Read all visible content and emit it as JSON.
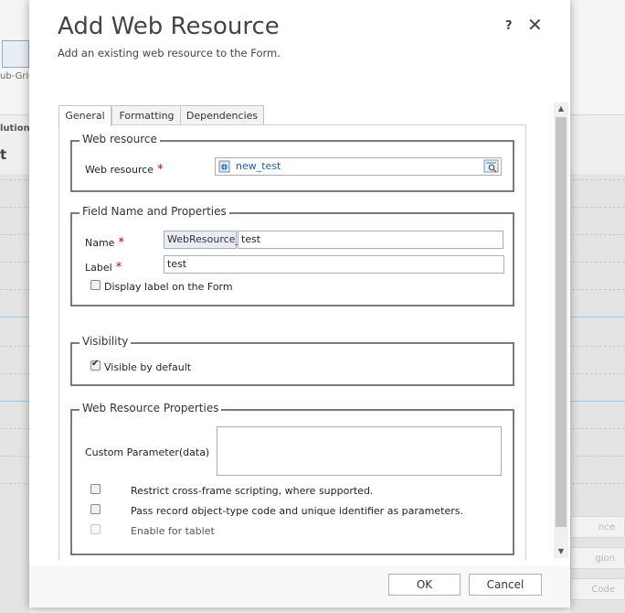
{
  "background": {
    "subgrid_label": "ub-Grid",
    "solution_label": "lution",
    "heading_fragment": "t",
    "right_fields": [
      "nce",
      "gion",
      "Code"
    ]
  },
  "dialog": {
    "title": "Add Web Resource",
    "subtitle": "Add an existing web resource to the Form.",
    "help_label": "?",
    "close_label": "✕"
  },
  "tabs": [
    {
      "label": "General",
      "active": true
    },
    {
      "label": "Formatting",
      "active": false
    },
    {
      "label": "Dependencies",
      "active": false
    }
  ],
  "web_resource": {
    "legend": "Web resource",
    "label": "Web resource",
    "required_mark": "*",
    "value": "new_test"
  },
  "field_name": {
    "legend": "Field Name and Properties",
    "name_label": "Name",
    "name_prefix": "WebResource_",
    "name_value": "test",
    "label_label": "Label",
    "label_value": "test",
    "required_mark": "*",
    "display_label_checkbox": "Display label on the Form",
    "display_label_checked": false
  },
  "visibility": {
    "legend": "Visibility",
    "visible_checkbox": "Visible by default",
    "visible_checked": true
  },
  "properties": {
    "legend": "Web Resource Properties",
    "custom_param_label": "Custom Parameter(data)",
    "custom_param_value": "",
    "restrict_label": "Restrict cross-frame scripting, where supported.",
    "pass_record_label": "Pass record object-type code and unique identifier as parameters.",
    "tablet_label": "Enable for tablet"
  },
  "footer": {
    "ok_label": "OK",
    "cancel_label": "Cancel"
  },
  "colors": {
    "required": "#c00000",
    "link": "#1f5c9e",
    "border": "#7a7a7a"
  }
}
